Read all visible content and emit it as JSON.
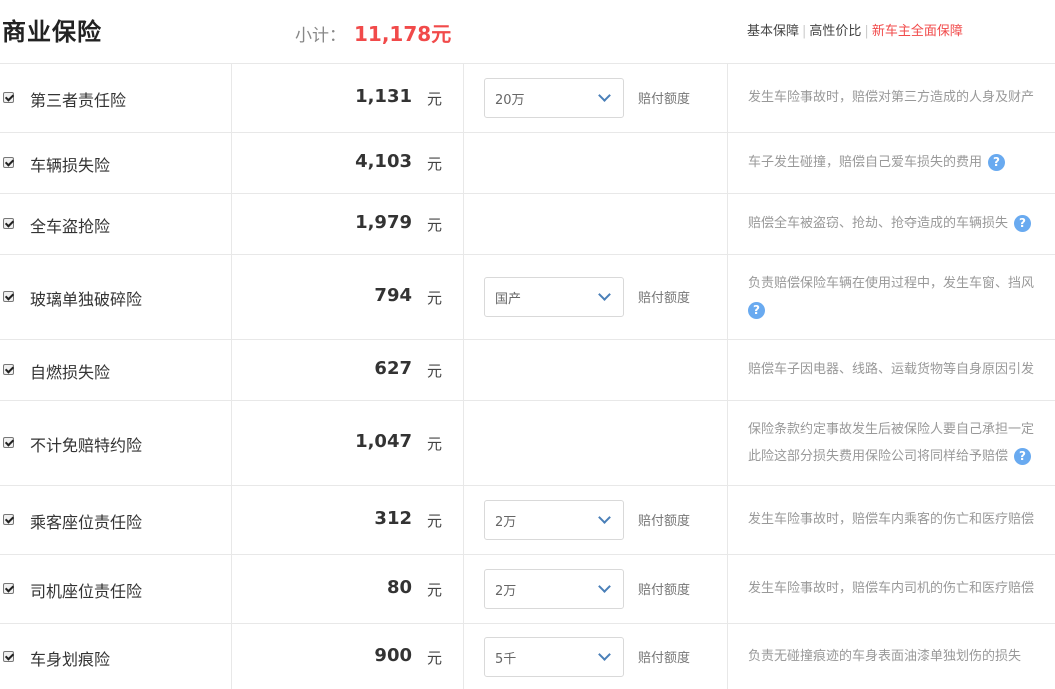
{
  "header": {
    "title": "商业保险",
    "subtotal_label": "小计：",
    "subtotal_value": "11,178",
    "subtotal_unit": "元",
    "plans": [
      "基本保障",
      "高性价比",
      "新车主全面保障"
    ],
    "active_plan": "新车主全面保障"
  },
  "common": {
    "unit": "元",
    "coverage_label": "赔付额度",
    "help_icon": "question-circle-icon"
  },
  "items": [
    {
      "name": "第三者责任险",
      "price": "1,131",
      "coverage": "20万",
      "desc1": "发生车险事故时，赔偿对第三方造成的人身及财产"
    },
    {
      "name": "车辆损失险",
      "price": "4,103",
      "desc1": "车子发生碰撞，赔偿自己爱车损失的费用"
    },
    {
      "name": "全车盗抢险",
      "price": "1,979",
      "desc1": "赔偿全车被盗窃、抢劫、抢夺造成的车辆损失"
    },
    {
      "name": "玻璃单独破碎险",
      "price": "794",
      "coverage": "国产",
      "desc1": "负责赔偿保险车辆在使用过程中，发生车窗、挡风"
    },
    {
      "name": "自燃损失险",
      "price": "627",
      "desc1": "赔偿车子因电器、线路、运载货物等自身原因引发"
    },
    {
      "name": "不计免赔特约险",
      "price": "1,047",
      "desc1": "保险条款约定事故发生后被保险人要自己承担一定",
      "desc2": "此险这部分损失费用保险公司将同样给予赔偿"
    },
    {
      "name": "乘客座位责任险",
      "price": "312",
      "coverage": "2万",
      "desc1": "发生车险事故时，赔偿车内乘客的伤亡和医疗赔偿"
    },
    {
      "name": "司机座位责任险",
      "price": "80",
      "coverage": "2万",
      "desc1": "发生车险事故时，赔偿车内司机的伤亡和医疗赔偿"
    },
    {
      "name": "车身划痕险",
      "price": "900",
      "coverage": "5千",
      "desc1": "负责无碰撞痕迹的车身表面油漆单独划伤的损失"
    }
  ]
}
